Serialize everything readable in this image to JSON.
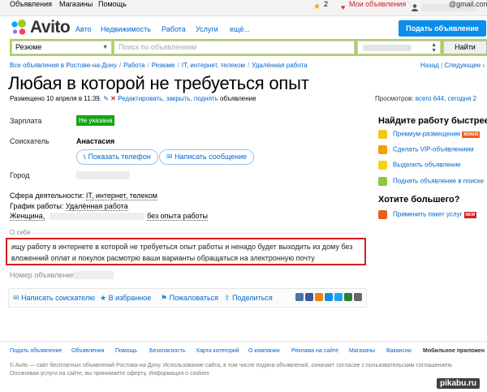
{
  "topbar": {
    "ads": "Объявления",
    "shops": "Магазины",
    "help": "Помощь",
    "fav_count": "2",
    "my_ads": "Мои объявления",
    "email_suffix": "@gmail.com"
  },
  "header": {
    "logo": "Avito",
    "nav": [
      "Авто",
      "Недвижимость",
      "Работа",
      "Услуги",
      "ещё..."
    ],
    "post_button": "Подать объявление"
  },
  "search": {
    "category": "Резюме",
    "placeholder": "Поиск по объявлениям",
    "find_button": "Найти"
  },
  "breadcrumbs": [
    "Все объявления в Ростове-на-Дону",
    "Работа",
    "Резюме",
    "IT, интернет, телеком",
    "Удалённая работа"
  ],
  "pager": {
    "back": "Назад",
    "next": "Следующее"
  },
  "ad": {
    "title": "Любая в которой не требуеться опыт",
    "posted": "Размещено 10 апреля в 11:39.",
    "edit_link": "Редактировать, закрыть, поднять",
    "edit_suffix": "объявление",
    "salary_label": "Зарплата",
    "salary_value": "Не указана",
    "seeker_label": "Соискатель",
    "seeker_name": "Анастасия",
    "show_phone": "Показать телефон",
    "write_message": "Написать сообщение",
    "city_label": "Город",
    "sphere_label": "Сфера деятельности:",
    "sphere_value": "IT, интернет, телеком",
    "schedule_label": "График работы:",
    "schedule_value": "Удалённая работа",
    "gender": "Женщина,",
    "experience": "без опыта работы",
    "about_label": "О себе",
    "about_text": "ищу работу в интернете в которой не требуеться опыт работы и ненадо будет выходить из дому без вложенний оплат и покулок расмотрю ваши варианты обращаться на электронную почту",
    "number_label": "Номер объявления:"
  },
  "actions": {
    "write_seeker": "Написать соискателю",
    "to_favorites": "В избранное",
    "complain": "Пожаловаться",
    "share": "Поделиться"
  },
  "views": {
    "label": "Просмотров:",
    "total": "всего 644, сегодня 2"
  },
  "sidebar": {
    "heading1": "Найдите работу быстрее!",
    "items": [
      {
        "label": "Премиум-размещение",
        "icon": "premium-icon",
        "badge": "BONUS"
      },
      {
        "label": "Сделать VIP-объявлением",
        "icon": "vip-icon"
      },
      {
        "label": "Выделить объявление",
        "icon": "highlight-icon"
      },
      {
        "label": "Поднять объявление в поиске",
        "icon": "raise-icon"
      }
    ],
    "heading2": "Хотите большего?",
    "package": "Применить пакет услуг",
    "package_badge": "NEW"
  },
  "footer": {
    "links": [
      "Подать объявление",
      "Объявления",
      "Помощь",
      "Безопасность",
      "Карта категорий",
      "О компании",
      "Реклама на сайте",
      "Магазины",
      "Вакансии"
    ],
    "mobile": "Мобильное приложен",
    "note1": "© Avito — сайт бесплатных объявлений Ростова-на-Дону. Использование сайта, в том числе подача объявлений, означает согласие с пользовательским соглашением.",
    "note2": "Оплачивая услуги на сайте, вы принимаете оферту. Информация о cookies",
    "watermark": "pikabu.ru"
  },
  "colors": {
    "accent_blue": "#0066cc",
    "post_button": "#0a8eea",
    "search_green": "#a7d453",
    "salary_badge": "#15a515",
    "highlight_border": "#d42020"
  }
}
